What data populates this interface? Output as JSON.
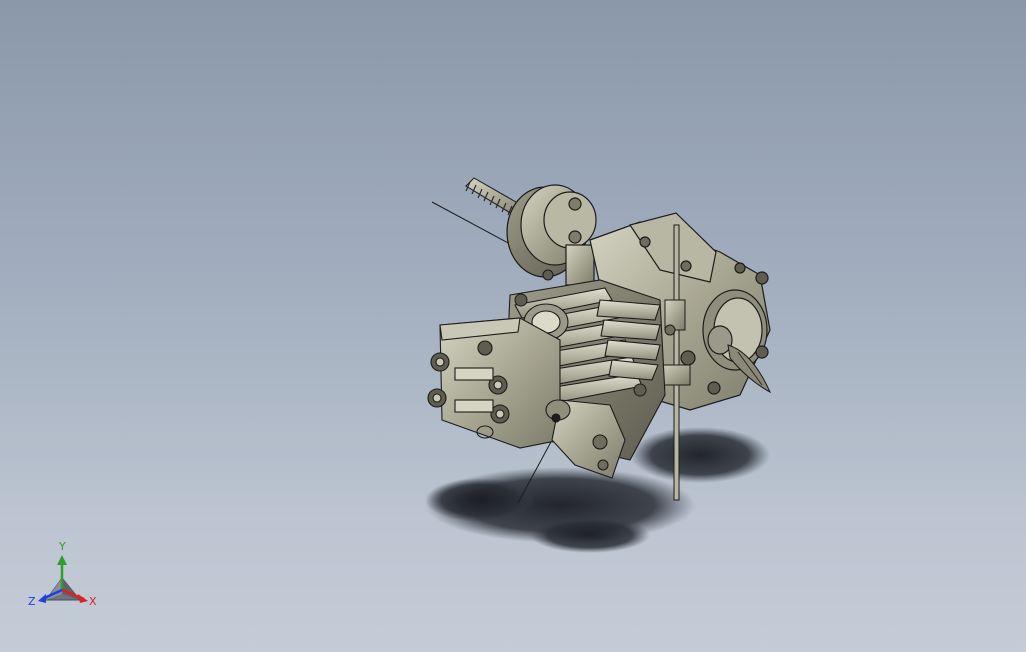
{
  "viewport": {
    "background_top": "#8b98aa",
    "background_bottom": "#c4ccd7"
  },
  "model": {
    "icon": "engine-assembly-icon",
    "body_color": "#a6a591",
    "edge_color": "#1c1c1c"
  },
  "triad": {
    "icon": "view-orientation-triad-icon",
    "axes": {
      "y": {
        "label": "Y",
        "color": "#2f9e2f"
      },
      "x": {
        "label": "X",
        "color": "#e02020"
      },
      "z": {
        "label": "Z",
        "color": "#2040e0"
      }
    }
  }
}
